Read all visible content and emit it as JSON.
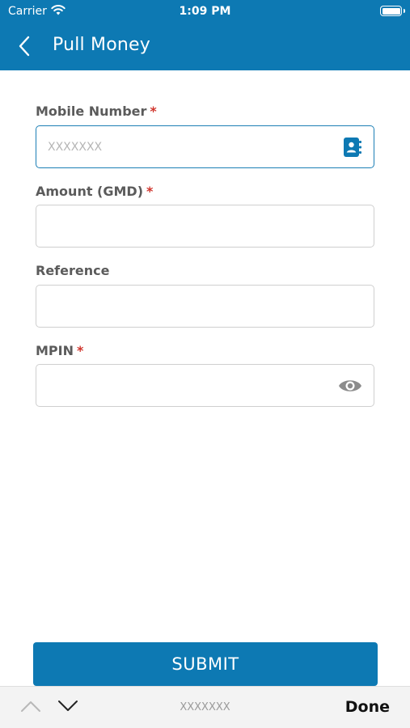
{
  "status_bar": {
    "carrier": "Carrier",
    "time": "1:09 PM"
  },
  "header": {
    "title": "Pull Money"
  },
  "form": {
    "mobile": {
      "label": "Mobile Number",
      "required_mark": "*",
      "placeholder": "XXXXXXX",
      "value": ""
    },
    "amount": {
      "label": "Amount (GMD)",
      "required_mark": "*",
      "value": ""
    },
    "reference": {
      "label": "Reference",
      "value": ""
    },
    "mpin": {
      "label": "MPIN",
      "required_mark": "*",
      "value": ""
    }
  },
  "submit_label": "SUBMIT",
  "keyboard_toolbar": {
    "preview_text": "XXXXXXX",
    "done_label": "Done"
  },
  "colors": {
    "brand": "#0d79b3",
    "required": "#d0342c",
    "active_border": "#1c7fb5"
  },
  "icons": [
    "back-chevron-icon",
    "wifi-icon",
    "battery-icon",
    "contact-book-icon",
    "eye-icon",
    "chevron-up-icon",
    "chevron-down-icon"
  ]
}
